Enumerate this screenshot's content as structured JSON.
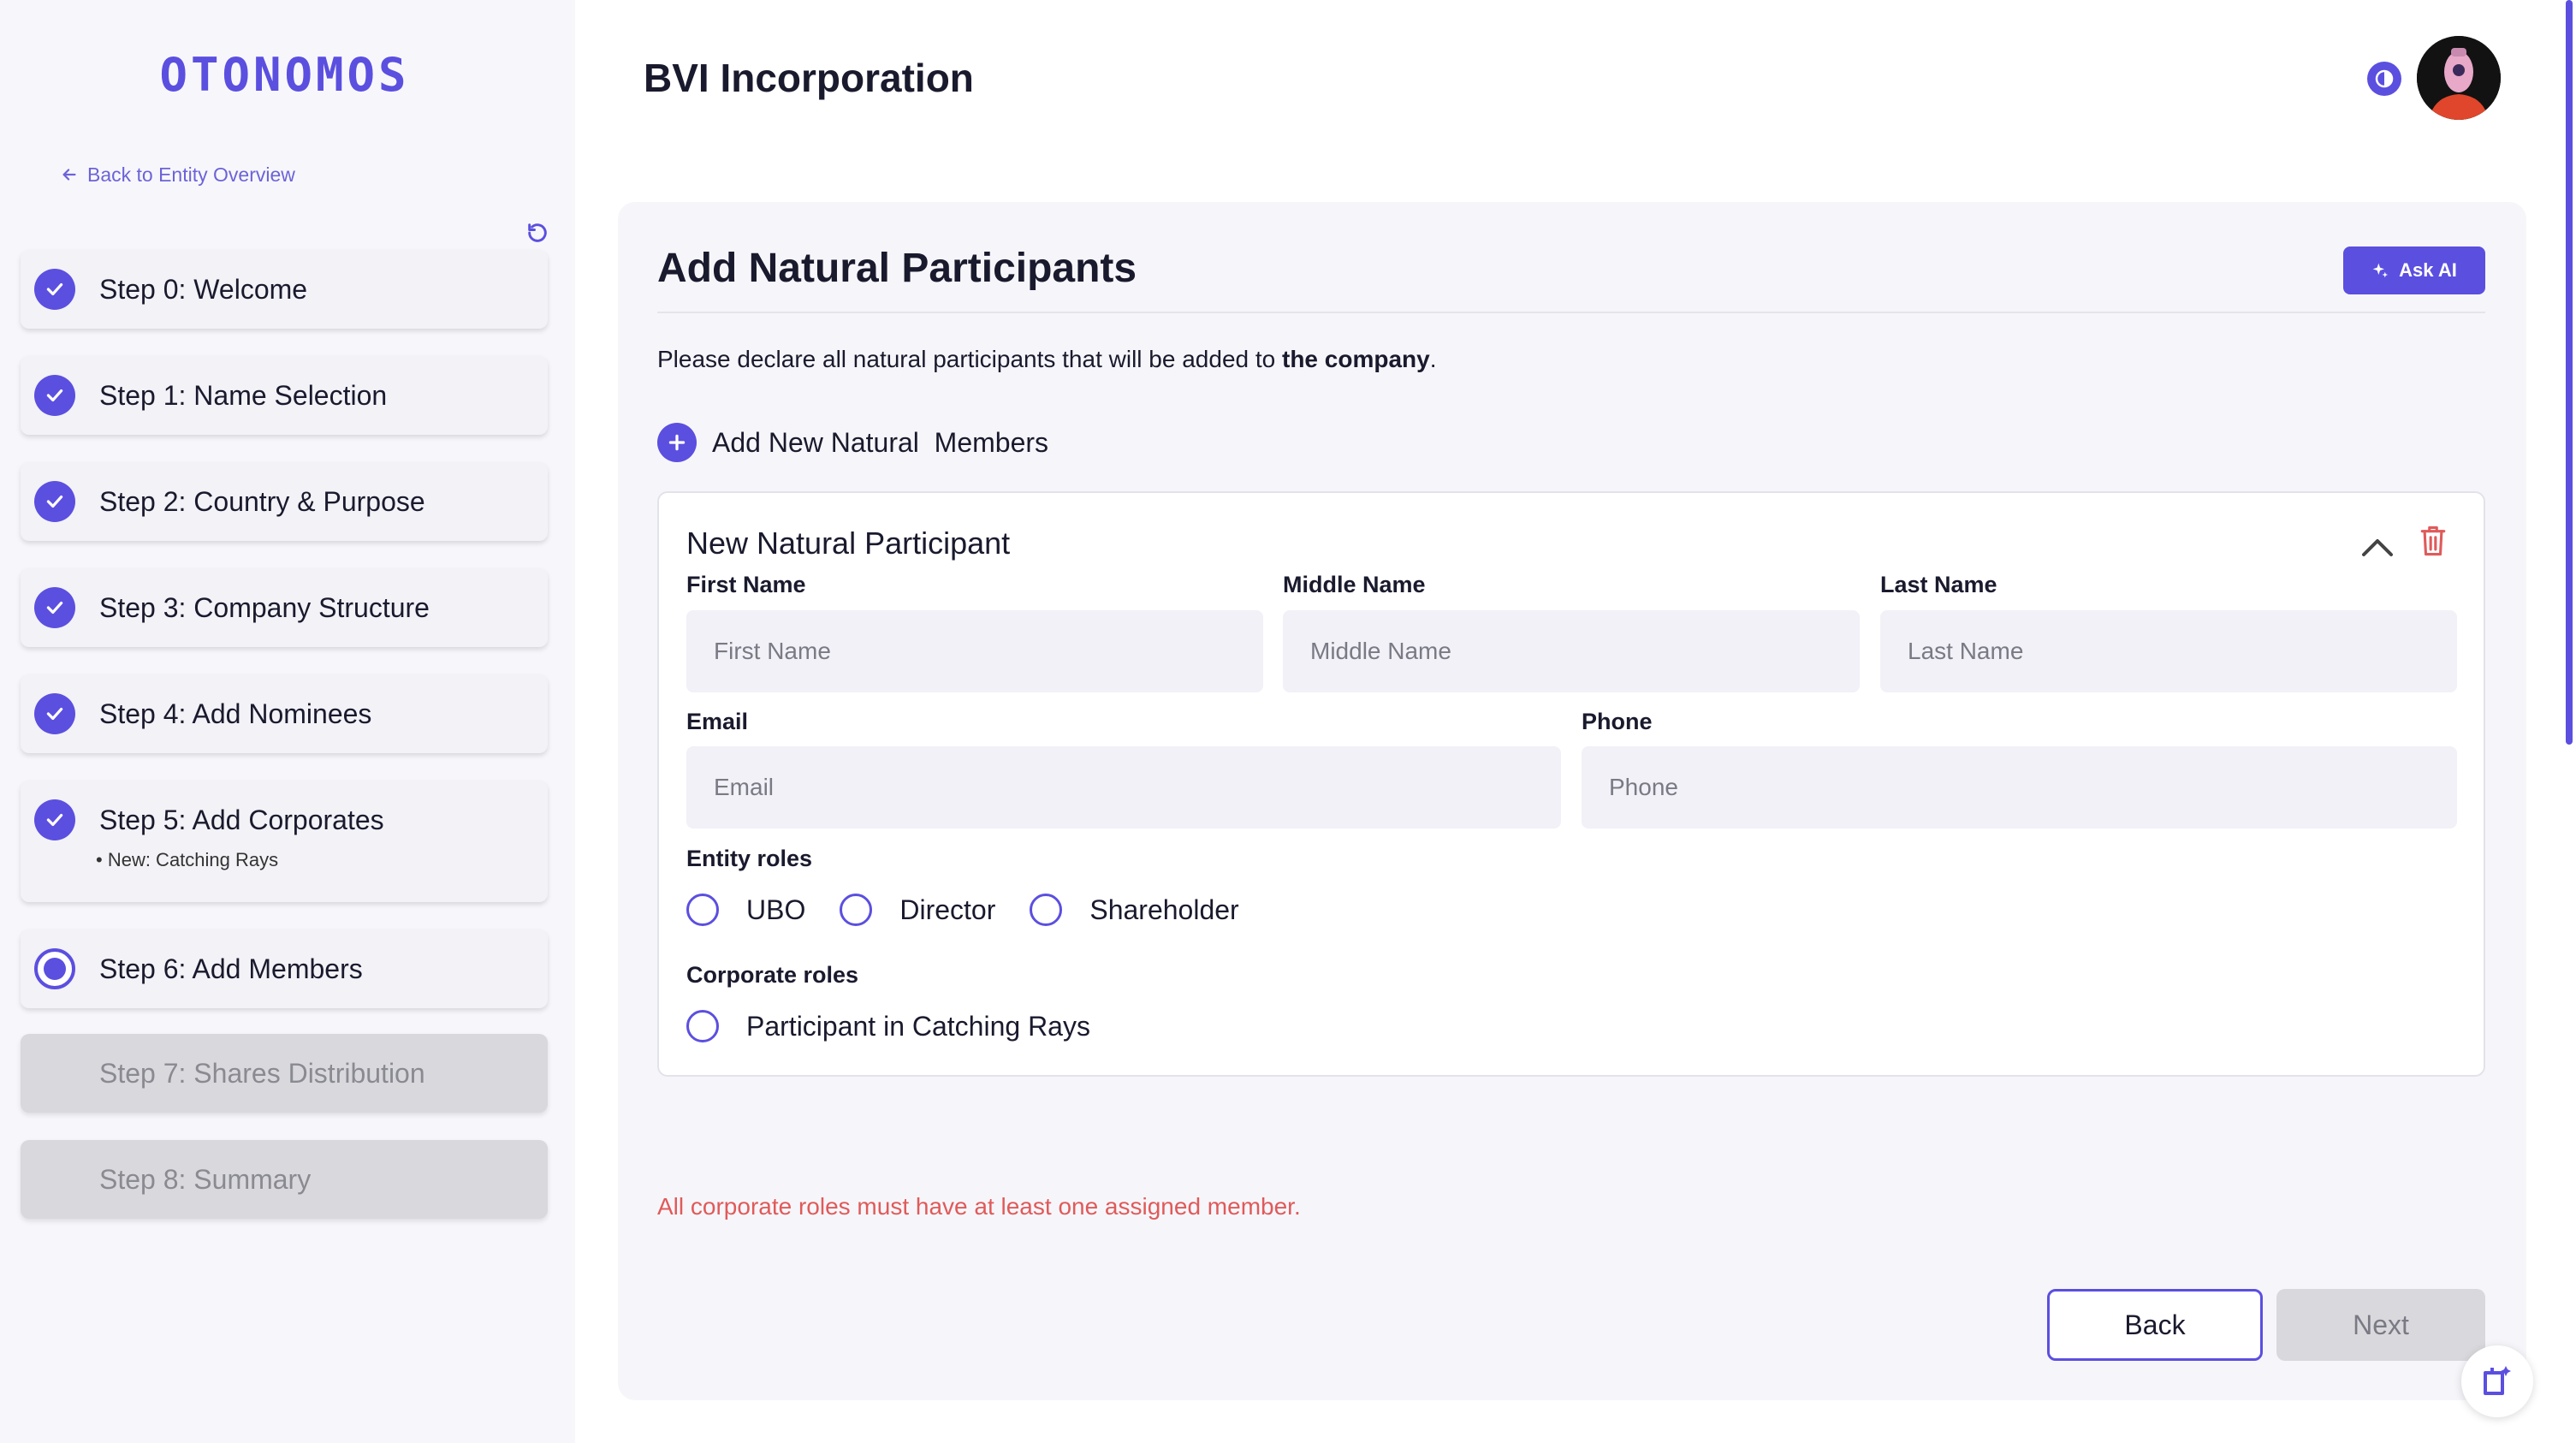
{
  "sidebar": {
    "logo": "OTONOMOS",
    "back_link": "Back to Entity Overview",
    "steps": [
      {
        "label": "Step 0: Welcome",
        "status": "done"
      },
      {
        "label": "Step 1: Name Selection",
        "status": "done"
      },
      {
        "label": "Step 2: Country & Purpose",
        "status": "done"
      },
      {
        "label": "Step 3: Company Structure",
        "status": "done"
      },
      {
        "label": "Step 4: Add Nominees",
        "status": "done"
      },
      {
        "label": "Step 5: Add Corporates",
        "status": "done",
        "sub": "• New: Catching Rays"
      },
      {
        "label": "Step 6: Add Members",
        "status": "current"
      },
      {
        "label": "Step 7: Shares Distribution",
        "status": "disabled"
      },
      {
        "label": "Step 8: Summary",
        "status": "disabled"
      }
    ]
  },
  "header": {
    "title": "BVI Incorporation"
  },
  "main": {
    "card_title": "Add Natural Participants",
    "ask_ai": "Ask AI",
    "description_prefix": "Please declare all natural participants that will be added to ",
    "description_bold": "the company",
    "description_suffix": ".",
    "add_members": "Add New Natural  Members",
    "participant": {
      "title": "New Natural Participant",
      "first_name_label": "First Name",
      "first_name_placeholder": "First Name",
      "middle_name_label": "Middle Name",
      "middle_name_placeholder": "Middle Name",
      "last_name_label": "Last Name",
      "last_name_placeholder": "Last Name",
      "email_label": "Email",
      "email_placeholder": "Email",
      "phone_label": "Phone",
      "phone_placeholder": "Phone",
      "entity_roles_label": "Entity roles",
      "entity_roles": [
        "UBO",
        "Director",
        "Shareholder"
      ],
      "corporate_roles_label": "Corporate roles",
      "corporate_roles": [
        "Participant in Catching Rays"
      ]
    },
    "error": "All corporate roles must have at least one assigned member.",
    "back_button": "Back",
    "next_button": "Next"
  },
  "colors": {
    "accent": "#5b4fe0",
    "error": "#e05a5a",
    "disabled": "#d9d9dd"
  }
}
